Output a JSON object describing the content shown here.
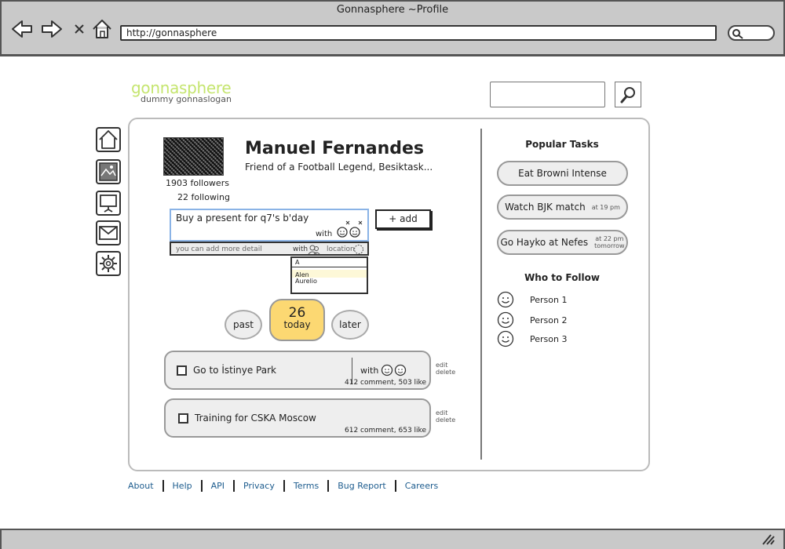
{
  "window": {
    "title": "Gonnasphere ~Profile",
    "url": "http://gonnasphere"
  },
  "site": {
    "logo": "gonnasphere",
    "slogan": "dummy gonnaslogan",
    "search_placeholder": ""
  },
  "profile": {
    "name": "Manuel Fernandes",
    "bio": "Friend of a Football Legend, Besiktask...",
    "followers": "1903 followers",
    "following": "22 following"
  },
  "composer": {
    "value": "Buy a present for q7's b'day",
    "with_label": "with",
    "detail_hint": "you can add more detail",
    "detail_with": "with",
    "detail_location": "location",
    "add_label": "+ add",
    "dropdown_query": "A",
    "dropdown_options": [
      "Alen",
      "Aurelio"
    ]
  },
  "timeline": {
    "past": "past",
    "today_day": "26",
    "today_label": "today",
    "later": "later"
  },
  "tasks": [
    {
      "title": "Go to İstinye Park",
      "with_label": "with",
      "stats": "412 comment, 503 like",
      "edit": "edit",
      "delete": "delete"
    },
    {
      "title": "Training for CSKA Moscow",
      "stats": "612 comment, 653 like",
      "edit": "edit",
      "delete": "delete"
    }
  ],
  "popular": {
    "heading": "Popular Tasks",
    "items": [
      {
        "label": "Eat Browni Intense",
        "time": ""
      },
      {
        "label": "Watch BJK match",
        "time": "at 19 pm"
      },
      {
        "label": "Go Hayko at Nefes",
        "time": "at 22 pm",
        "time2": "tomorrow"
      }
    ]
  },
  "who_to_follow": {
    "heading": "Who to Follow",
    "people": [
      "Person 1",
      "Person 2",
      "Person 3"
    ]
  },
  "footer": [
    "About",
    "Help",
    "API",
    "Privacy",
    "Terms",
    "Bug Report",
    "Careers"
  ],
  "colors": {
    "logo": "#c5e56f",
    "today": "#fcd872",
    "input_border": "#8ab3e6",
    "footer_link": "#1d5c8e"
  },
  "icons": {
    "sidebar": [
      "home-icon",
      "photo-icon",
      "presentation-icon",
      "mail-icon",
      "gear-icon"
    ],
    "browser": [
      "back-arrow-icon",
      "forward-arrow-icon",
      "close-icon",
      "home-icon"
    ]
  }
}
